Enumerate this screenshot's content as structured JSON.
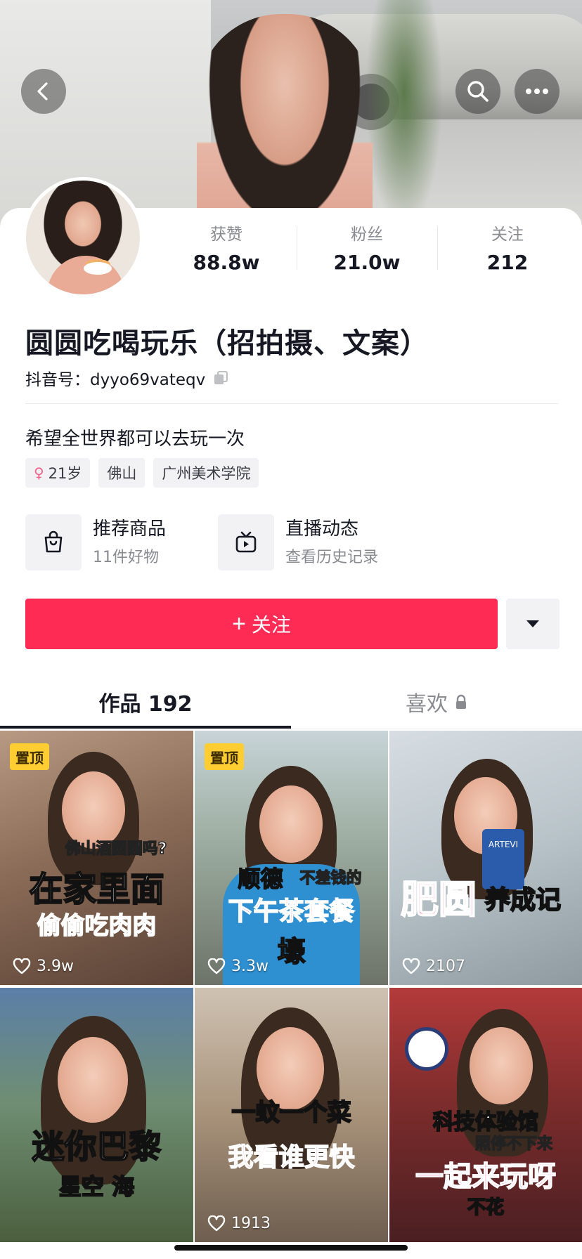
{
  "nav": {
    "back_icon": "chevron-left-icon",
    "search_icon": "search-icon",
    "more_icon": "more-dots-icon"
  },
  "profile": {
    "stats": [
      {
        "label": "获赞",
        "value": "88.8w"
      },
      {
        "label": "粉丝",
        "value": "21.0w"
      },
      {
        "label": "关注",
        "value": "212"
      }
    ],
    "name": "圆圆吃喝玩乐（招拍摄、文案）",
    "handle": "抖音号：dyyo69vateqv",
    "bio": "希望全世界都可以去玩一次",
    "tags": {
      "gender_symbol": "♀",
      "age": "21岁",
      "city": "佛山",
      "school": "广州美术学院"
    }
  },
  "shortcuts": [
    {
      "title": "推荐商品",
      "subtitle": "11件好物",
      "icon": "shopping-bag-icon"
    },
    {
      "title": "直播动态",
      "subtitle": "查看历史记录",
      "icon": "tv-play-icon"
    }
  ],
  "actions": {
    "follow_plus": "+",
    "follow_label": "关注",
    "accent": "#fe2c55"
  },
  "tabs": {
    "works": "作品 192",
    "likes": "喜欢"
  },
  "videos": [
    {
      "pinned": "置顶",
      "caption_top": "佛山酒圆圆吗?",
      "caption_main": "在家里面",
      "caption_sub": "偷偷吃肉肉",
      "likes": "3.9w"
    },
    {
      "pinned": "置顶",
      "caption_top": "顺德",
      "caption_tag": "不差钱的",
      "caption_main": "下午茶套餐",
      "caption_sub": "壕",
      "likes": "3.3w"
    },
    {
      "caption_main": "肥圆",
      "caption_sub": "养成记",
      "cup_text": "ARTEVI",
      "likes": "2107"
    },
    {
      "caption_main": "迷你巴黎",
      "caption_sub": "星空 海"
    },
    {
      "caption_top": "一蚊一个菜",
      "caption_main": "我看谁更快",
      "likes": "1913"
    },
    {
      "caption_top": "科技体验馆",
      "caption_tag": "照停不下来",
      "caption_main": "一起来玩呀",
      "caption_sub": "不花"
    }
  ]
}
